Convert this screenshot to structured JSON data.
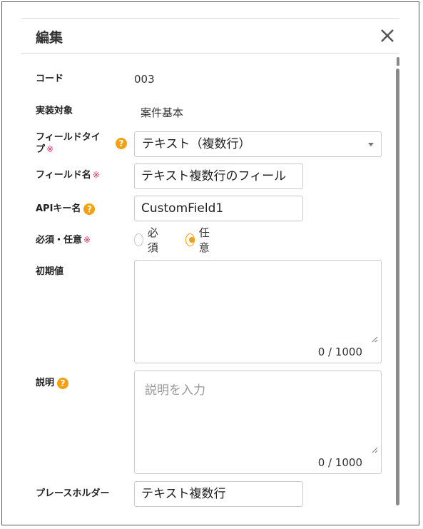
{
  "dialog": {
    "title": "編集",
    "close_icon": "close-icon"
  },
  "fields": {
    "code": {
      "label": "コード",
      "value": "003"
    },
    "target": {
      "label": "実装対象",
      "value": "案件基本"
    },
    "field_type": {
      "label": "フィールドタイプ",
      "required_mark": "※",
      "selected": "テキスト（複数行）"
    },
    "field_name": {
      "label": "フィールド名",
      "required_mark": "※",
      "value": "テキスト複数行のフィール"
    },
    "api_key": {
      "label": "APIキー名",
      "value": "CustomField1"
    },
    "required": {
      "label": "必須・任意",
      "required_mark": "※",
      "options": [
        "必須",
        "任意"
      ],
      "selected": "任意"
    },
    "initial": {
      "label": "初期値",
      "value": "",
      "counter": "0 / 1000"
    },
    "description": {
      "label": "説明",
      "placeholder": "説明を入力",
      "counter": "0 / 1000"
    },
    "placeholder_field": {
      "label": "プレースホルダー",
      "value": "テキスト複数行"
    }
  },
  "colors": {
    "accent": "#f5a010",
    "required": "#e0245e",
    "border": "#c9c9c9"
  }
}
